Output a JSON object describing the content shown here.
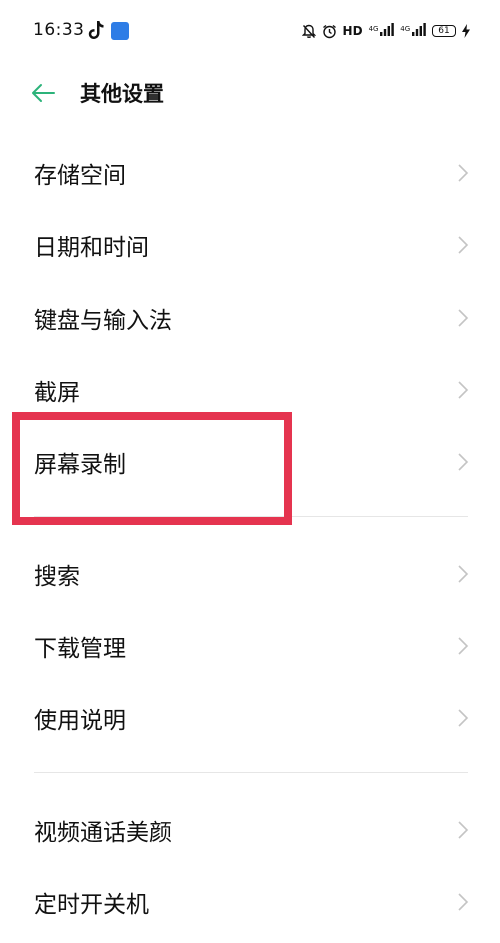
{
  "status_bar": {
    "time": "16:33",
    "hd_label": "HD",
    "net_label_1": "4G",
    "net_label_2": "4G",
    "battery_level": "61"
  },
  "header": {
    "title": "其他设置"
  },
  "colors": {
    "accent": "#2cb37a",
    "highlight": "#e5344f",
    "divider": "#e6e6e6"
  },
  "settings_list": {
    "items": [
      {
        "label": "存储空间"
      },
      {
        "label": "日期和时间"
      },
      {
        "label": "键盘与输入法"
      },
      {
        "label": "截屏"
      },
      {
        "label": "屏幕录制"
      },
      {
        "label": "搜索"
      },
      {
        "label": "下载管理"
      },
      {
        "label": "使用说明"
      },
      {
        "label": "视频通话美颜"
      },
      {
        "label": "定时开关机"
      }
    ]
  }
}
